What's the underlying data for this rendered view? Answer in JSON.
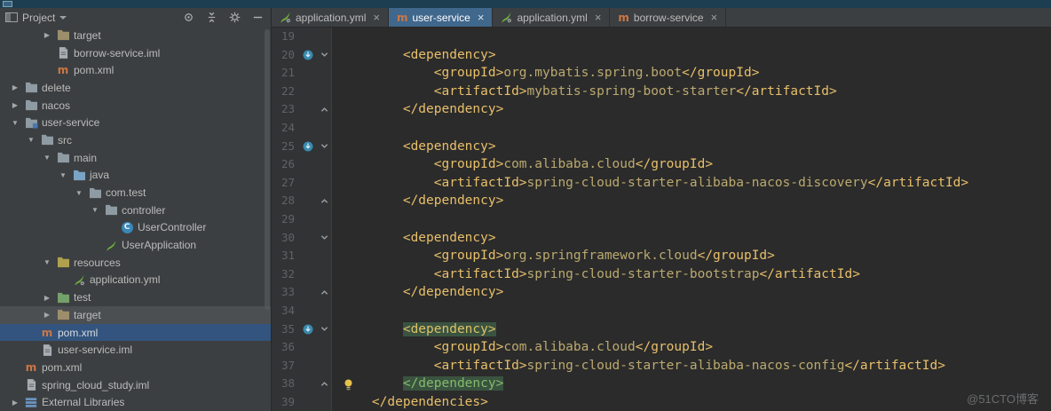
{
  "watermark": "@51CTO博客",
  "project_panel": {
    "title": "Project",
    "header_icons": [
      "locate",
      "collapse-all",
      "settings",
      "hide"
    ],
    "tree": [
      {
        "label": "target",
        "icon": "target-folder",
        "arrow": "right",
        "level": 2
      },
      {
        "label": "borrow-service.iml",
        "icon": "iml-file",
        "level": 2
      },
      {
        "label": "pom.xml",
        "icon": "maven-file",
        "level": 2
      },
      {
        "label": "delete",
        "icon": "folder",
        "arrow": "right",
        "level": 0
      },
      {
        "label": "nacos",
        "icon": "folder",
        "arrow": "right",
        "level": 0
      },
      {
        "label": "user-service",
        "icon": "module-folder",
        "arrow": "down",
        "level": 0
      },
      {
        "label": "src",
        "icon": "folder",
        "arrow": "down",
        "level": 1
      },
      {
        "label": "main",
        "icon": "folder",
        "arrow": "down",
        "level": 2
      },
      {
        "label": "java",
        "icon": "source-folder",
        "arrow": "down",
        "level": 3
      },
      {
        "label": "com.test",
        "icon": "package-folder",
        "arrow": "down",
        "level": 4
      },
      {
        "label": "controller",
        "icon": "package-folder",
        "arrow": "down",
        "level": 5
      },
      {
        "label": "UserController",
        "icon": "class",
        "level": 6
      },
      {
        "label": "UserApplication",
        "icon": "spring-boot-class",
        "level": 5
      },
      {
        "label": "resources",
        "icon": "resources-folder",
        "arrow": "down",
        "level": 2
      },
      {
        "label": "application.yml",
        "icon": "spring-config",
        "level": 3
      },
      {
        "label": "test",
        "icon": "test-folder",
        "arrow": "right",
        "level": 2
      },
      {
        "label": "target",
        "icon": "target-folder",
        "arrow": "right",
        "level": 2,
        "state": "hover"
      },
      {
        "label": "pom.xml",
        "icon": "maven-file",
        "level": 1,
        "state": "selected"
      },
      {
        "label": "user-service.iml",
        "icon": "iml-file",
        "level": 1
      },
      {
        "label": "pom.xml",
        "icon": "maven-file",
        "level": 0
      },
      {
        "label": "spring_cloud_study.iml",
        "icon": "iml-file",
        "level": 0
      },
      {
        "label": "External Libraries",
        "icon": "libraries",
        "arrow": "right",
        "level": 0
      }
    ]
  },
  "tabs": [
    {
      "label": "application.yml",
      "icon": "spring-config",
      "selected": false
    },
    {
      "label": "user-service",
      "icon": "maven-file",
      "selected": true
    },
    {
      "label": "application.yml",
      "icon": "spring-config",
      "selected": false
    },
    {
      "label": "borrow-service",
      "icon": "maven-file",
      "selected": false
    }
  ],
  "editor": {
    "lines": [
      {
        "n": "19",
        "s": []
      },
      {
        "n": "20",
        "g": "maven-dep",
        "f": "down",
        "s": [
          [
            "        ",
            ""
          ],
          [
            "<dependency>",
            "t"
          ]
        ]
      },
      {
        "n": "21",
        "s": [
          [
            "            ",
            ""
          ],
          [
            "<groupId>",
            "t"
          ],
          [
            "org.mybatis.spring.boot",
            "x"
          ],
          [
            "</groupId>",
            "t"
          ]
        ]
      },
      {
        "n": "22",
        "s": [
          [
            "            ",
            ""
          ],
          [
            "<artifactId>",
            "t"
          ],
          [
            "mybatis-spring-boot-starter",
            "x"
          ],
          [
            "</artifactId>",
            "t"
          ]
        ]
      },
      {
        "n": "23",
        "f": "up",
        "s": [
          [
            "        ",
            ""
          ],
          [
            "</dependency>",
            "t"
          ]
        ]
      },
      {
        "n": "24",
        "s": []
      },
      {
        "n": "25",
        "g": "maven-dep",
        "f": "down",
        "s": [
          [
            "        ",
            ""
          ],
          [
            "<dependency>",
            "t"
          ]
        ]
      },
      {
        "n": "26",
        "s": [
          [
            "            ",
            ""
          ],
          [
            "<groupId>",
            "t"
          ],
          [
            "com.alibaba.cloud",
            "x"
          ],
          [
            "</groupId>",
            "t"
          ]
        ]
      },
      {
        "n": "27",
        "s": [
          [
            "            ",
            ""
          ],
          [
            "<artifactId>",
            "t"
          ],
          [
            "spring-cloud-starter-alibaba-nacos-discovery",
            "x"
          ],
          [
            "</artifactId>",
            "t"
          ]
        ]
      },
      {
        "n": "28",
        "f": "up",
        "s": [
          [
            "        ",
            ""
          ],
          [
            "</dependency>",
            "t"
          ]
        ]
      },
      {
        "n": "29",
        "s": []
      },
      {
        "n": "30",
        "f": "down",
        "s": [
          [
            "        ",
            ""
          ],
          [
            "<dependency>",
            "t"
          ]
        ]
      },
      {
        "n": "31",
        "s": [
          [
            "            ",
            ""
          ],
          [
            "<groupId>",
            "t"
          ],
          [
            "org.springframework.cloud",
            "x"
          ],
          [
            "</groupId>",
            "t"
          ]
        ]
      },
      {
        "n": "32",
        "s": [
          [
            "            ",
            ""
          ],
          [
            "<artifactId>",
            "t"
          ],
          [
            "spring-cloud-starter-bootstrap",
            "x"
          ],
          [
            "</artifactId>",
            "t"
          ]
        ]
      },
      {
        "n": "33",
        "f": "up",
        "s": [
          [
            "        ",
            ""
          ],
          [
            "</dependency>",
            "t"
          ]
        ]
      },
      {
        "n": "34",
        "s": []
      },
      {
        "n": "35",
        "g": "maven-dep",
        "f": "down",
        "s": [
          [
            "        ",
            ""
          ],
          [
            "<dependency>",
            "hlo"
          ]
        ]
      },
      {
        "n": "36",
        "s": [
          [
            "            ",
            ""
          ],
          [
            "<groupId>",
            "t"
          ],
          [
            "com.alibaba.cloud",
            "x"
          ],
          [
            "</groupId>",
            "t"
          ]
        ]
      },
      {
        "n": "37",
        "s": [
          [
            "            ",
            ""
          ],
          [
            "<artifactId>",
            "t"
          ],
          [
            "spring-cloud-starter-alibaba-nacos-config",
            "x"
          ],
          [
            "</artifactId>",
            "t"
          ]
        ]
      },
      {
        "n": "38",
        "f": "up",
        "bulb": true,
        "s": [
          [
            "        ",
            ""
          ],
          [
            "</dependency>",
            "hlc"
          ]
        ]
      },
      {
        "n": "39",
        "s": [
          [
            "    ",
            ""
          ],
          [
            "</dependencies>",
            "t"
          ]
        ]
      }
    ]
  }
}
